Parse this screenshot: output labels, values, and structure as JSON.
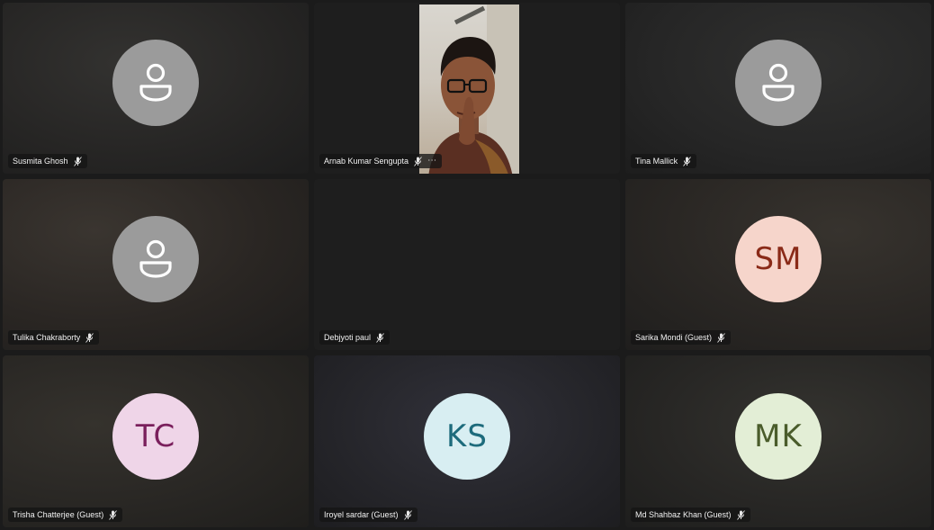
{
  "participants": [
    {
      "name": "Susmita Ghosh",
      "initials": "",
      "avatar_bg": "#9b9b9b",
      "avatar_fg": "#ffffff",
      "avatar_type": "person-icon"
    },
    {
      "name": "Arnab Kumar Sengupta",
      "initials": "",
      "avatar_type": "video",
      "has_more": true,
      "more_icon": "⋯"
    },
    {
      "name": "Tina Mallick",
      "initials": "",
      "avatar_bg": "#9b9b9b",
      "avatar_fg": "#ffffff",
      "avatar_type": "person-icon"
    },
    {
      "name": "Tulika Chakraborty",
      "initials": "",
      "avatar_bg": "#9b9b9b",
      "avatar_fg": "#ffffff",
      "avatar_type": "person-icon"
    },
    {
      "name": "Debjyoti paul",
      "initials": "",
      "avatar_type": "none"
    },
    {
      "name": "Sarika Mondi (Guest)",
      "initials": "SM",
      "avatar_bg": "#f6d5cb",
      "avatar_fg": "#8a2a18",
      "avatar_type": "initials"
    },
    {
      "name": "Trisha Chatterjee (Guest)",
      "initials": "TC",
      "avatar_bg": "#efd5e8",
      "avatar_fg": "#7a1f5c",
      "avatar_type": "initials"
    },
    {
      "name": "Iroyel sardar (Guest)",
      "initials": "KS",
      "avatar_bg": "#d8eef2",
      "avatar_fg": "#1d6b7c",
      "avatar_type": "initials"
    },
    {
      "name": "Md Shahbaz Khan (Guest)",
      "initials": "MK",
      "avatar_bg": "#e3eed6",
      "avatar_fg": "#4a5c2b",
      "avatar_type": "initials"
    }
  ],
  "icons": {
    "mic": "mic-icon",
    "person": "person-icon"
  }
}
